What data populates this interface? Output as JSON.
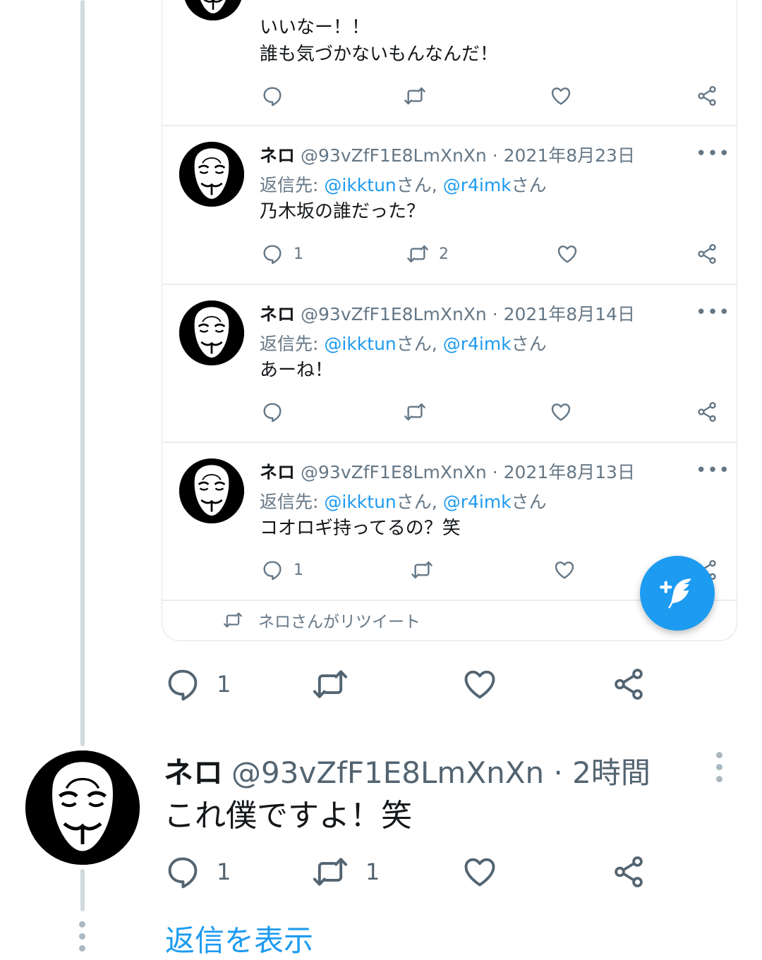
{
  "colors": {
    "accent": "#1d9bf0",
    "muted": "#657786",
    "text": "#14171a"
  },
  "embedded": {
    "top_tweet": {
      "lines": [
        "いいなー！！",
        "誰も気づかないもんなんだ！"
      ]
    },
    "tweets": [
      {
        "name": "ネロ",
        "meta": "@93vZfF1E8LmXnXn · 2021年8月23日",
        "reply_prefix": "返信先: ",
        "mention1": "@ikktun",
        "san1": "さん, ",
        "mention2": "@r4imk",
        "san2": "さん",
        "text": "乃木坂の誰だった？",
        "reply_count": "1",
        "retweet_count": "2"
      },
      {
        "name": "ネロ",
        "meta": "@93vZfF1E8LmXnXn · 2021年8月14日",
        "reply_prefix": "返信先: ",
        "mention1": "@ikktun",
        "san1": "さん, ",
        "mention2": "@r4imk",
        "san2": "さん",
        "text": "あーね！",
        "reply_count": "",
        "retweet_count": ""
      },
      {
        "name": "ネロ",
        "meta": "@93vZfF1E8LmXnXn · 2021年8月13日",
        "reply_prefix": "返信先: ",
        "mention1": "@ikktun",
        "san1": "さん, ",
        "mention2": "@r4imk",
        "san2": "さん",
        "text": "コオロギ持ってるの？笑",
        "reply_count": "1",
        "retweet_count": ""
      }
    ],
    "retweet_note": "ネロさんがリツイート",
    "more_glyph": "•••"
  },
  "quoted_actions": {
    "reply_count": "1",
    "retweet_count": ""
  },
  "main_tweet": {
    "name": "ネロ",
    "meta": "@93vZfF1E8LmXnXn · 2時間",
    "text": "これ僕ですよ！笑",
    "reply_count": "1",
    "retweet_count": "1"
  },
  "show_replies": "返信を表示",
  "icons": [
    "reply-icon",
    "retweet-icon",
    "like-icon",
    "share-icon",
    "more-icon",
    "compose-icon"
  ]
}
